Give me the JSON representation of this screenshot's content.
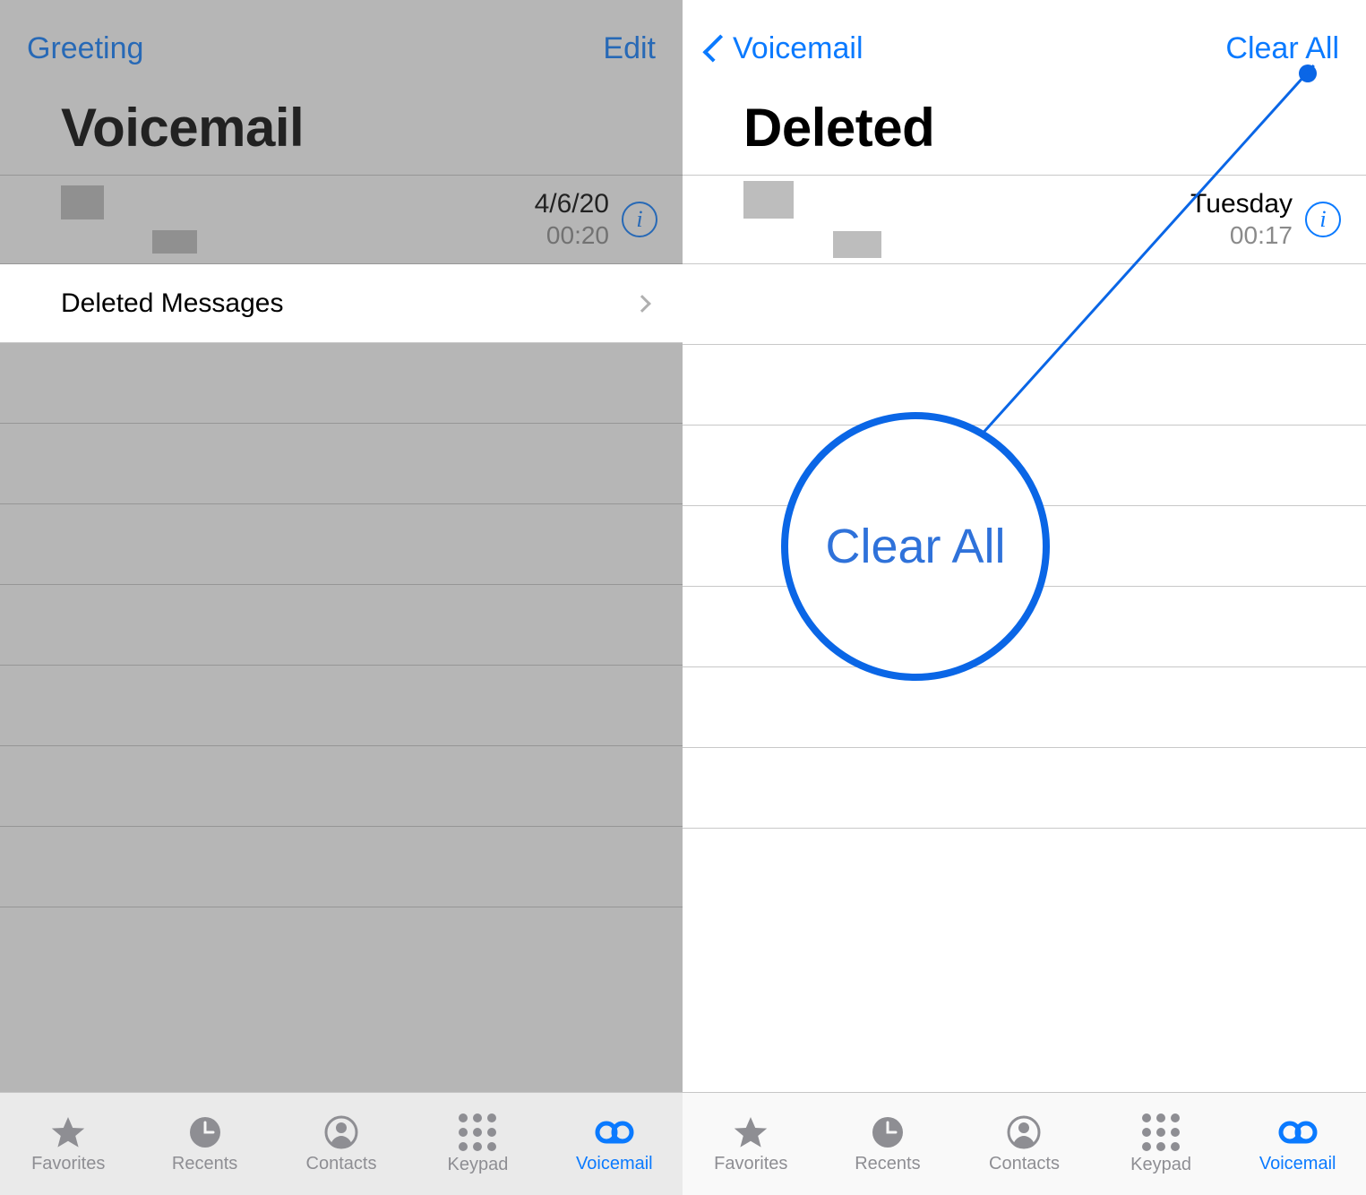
{
  "colors": {
    "accent": "#0a7aff",
    "annotation": "#0a66e6"
  },
  "left": {
    "nav": {
      "left_button": "Greeting",
      "right_button": "Edit"
    },
    "title": "Voicemail",
    "voicemail_item": {
      "date": "4/6/20",
      "duration": "00:20"
    },
    "deleted_row_label": "Deleted Messages"
  },
  "right": {
    "nav": {
      "back_label": "Voicemail",
      "right_button": "Clear All"
    },
    "title": "Deleted",
    "voicemail_item": {
      "date": "Tuesday",
      "duration": "00:17"
    },
    "annotation_label": "Clear All"
  },
  "tabbar": {
    "items": [
      {
        "label": "Favorites"
      },
      {
        "label": "Recents"
      },
      {
        "label": "Contacts"
      },
      {
        "label": "Keypad"
      },
      {
        "label": "Voicemail"
      }
    ],
    "active_index": 4
  }
}
